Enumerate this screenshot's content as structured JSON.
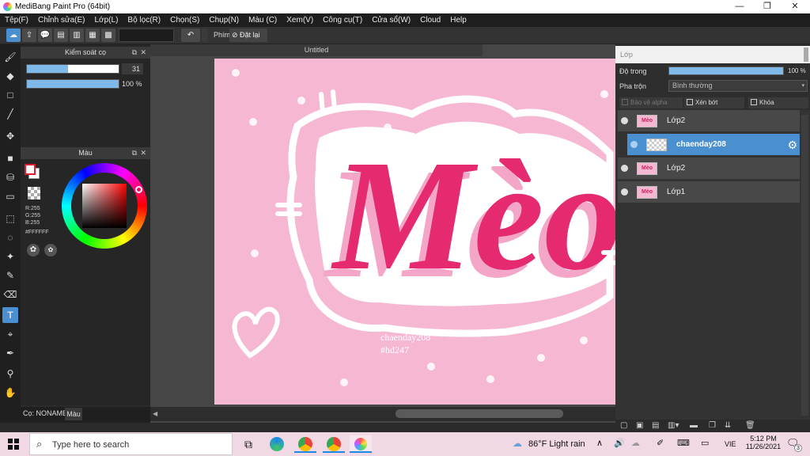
{
  "window": {
    "title": "MediBang Paint Pro (64bit)",
    "controls": [
      "—",
      "❐",
      "✕"
    ]
  },
  "menu": [
    "Tệp(F)",
    "Chỉnh sửa(E)",
    "Lớp(L)",
    "Bộ lọc(R)",
    "Chọn(S)",
    "Chụp(N)",
    "Màu (C)",
    "Xem(V)",
    "Công cụ(T)",
    "Cửa sổ(W)",
    "Cloud",
    "Help"
  ],
  "toolbar": {
    "phim_label": "Phím",
    "reset_label": "Đặt lại"
  },
  "brush_panel": {
    "title": "Kiểm soát cọ",
    "size_value": "31",
    "size_fraction": 0.45,
    "opacity_value": "100 %",
    "opacity_fraction": 1.0
  },
  "color_panel": {
    "title": "Màu",
    "r": "R:255",
    "g": "G:255",
    "b": "B:255",
    "hex": "#FFFFFF",
    "fg_color": "#e01b2d",
    "bg_color": "#ffffff"
  },
  "left_bottom": {
    "brush_tab": "Cọ: NONAME",
    "color_tab": "Màu"
  },
  "document": {
    "tab": "Untitled",
    "canvas_color": "#f6b7d3",
    "letters": "Mèo",
    "letter_color": "#e52a6f",
    "credit_1": "chaenday208",
    "credit_2": "#hd247"
  },
  "layer_panel": {
    "title": "Lớp",
    "opacity_label": "Độ trong",
    "opacity_value": "100 %",
    "opacity_fraction": 1.0,
    "blend_label": "Pha trộn",
    "blend_value": "Bình thường",
    "protect_alpha": "Bảo vệ alpha",
    "clip": "Xén bớt",
    "lock": "Khóa",
    "layers": [
      {
        "name": "Lớp2",
        "thumb": "Mèo",
        "selected": false
      },
      {
        "name": "chaenday208",
        "thumb": "",
        "selected": true
      },
      {
        "name": "Lớp2",
        "thumb": "Mèo",
        "selected": false
      },
      {
        "name": "Lớp1",
        "thumb": "Mèo",
        "selected": false
      }
    ]
  },
  "taskbar": {
    "search_placeholder": "Type here to search",
    "weather": "86°F  Light rain",
    "lang": "VIE",
    "time": "5:12 PM",
    "date": "11/26/2021",
    "notif_count": "3"
  }
}
